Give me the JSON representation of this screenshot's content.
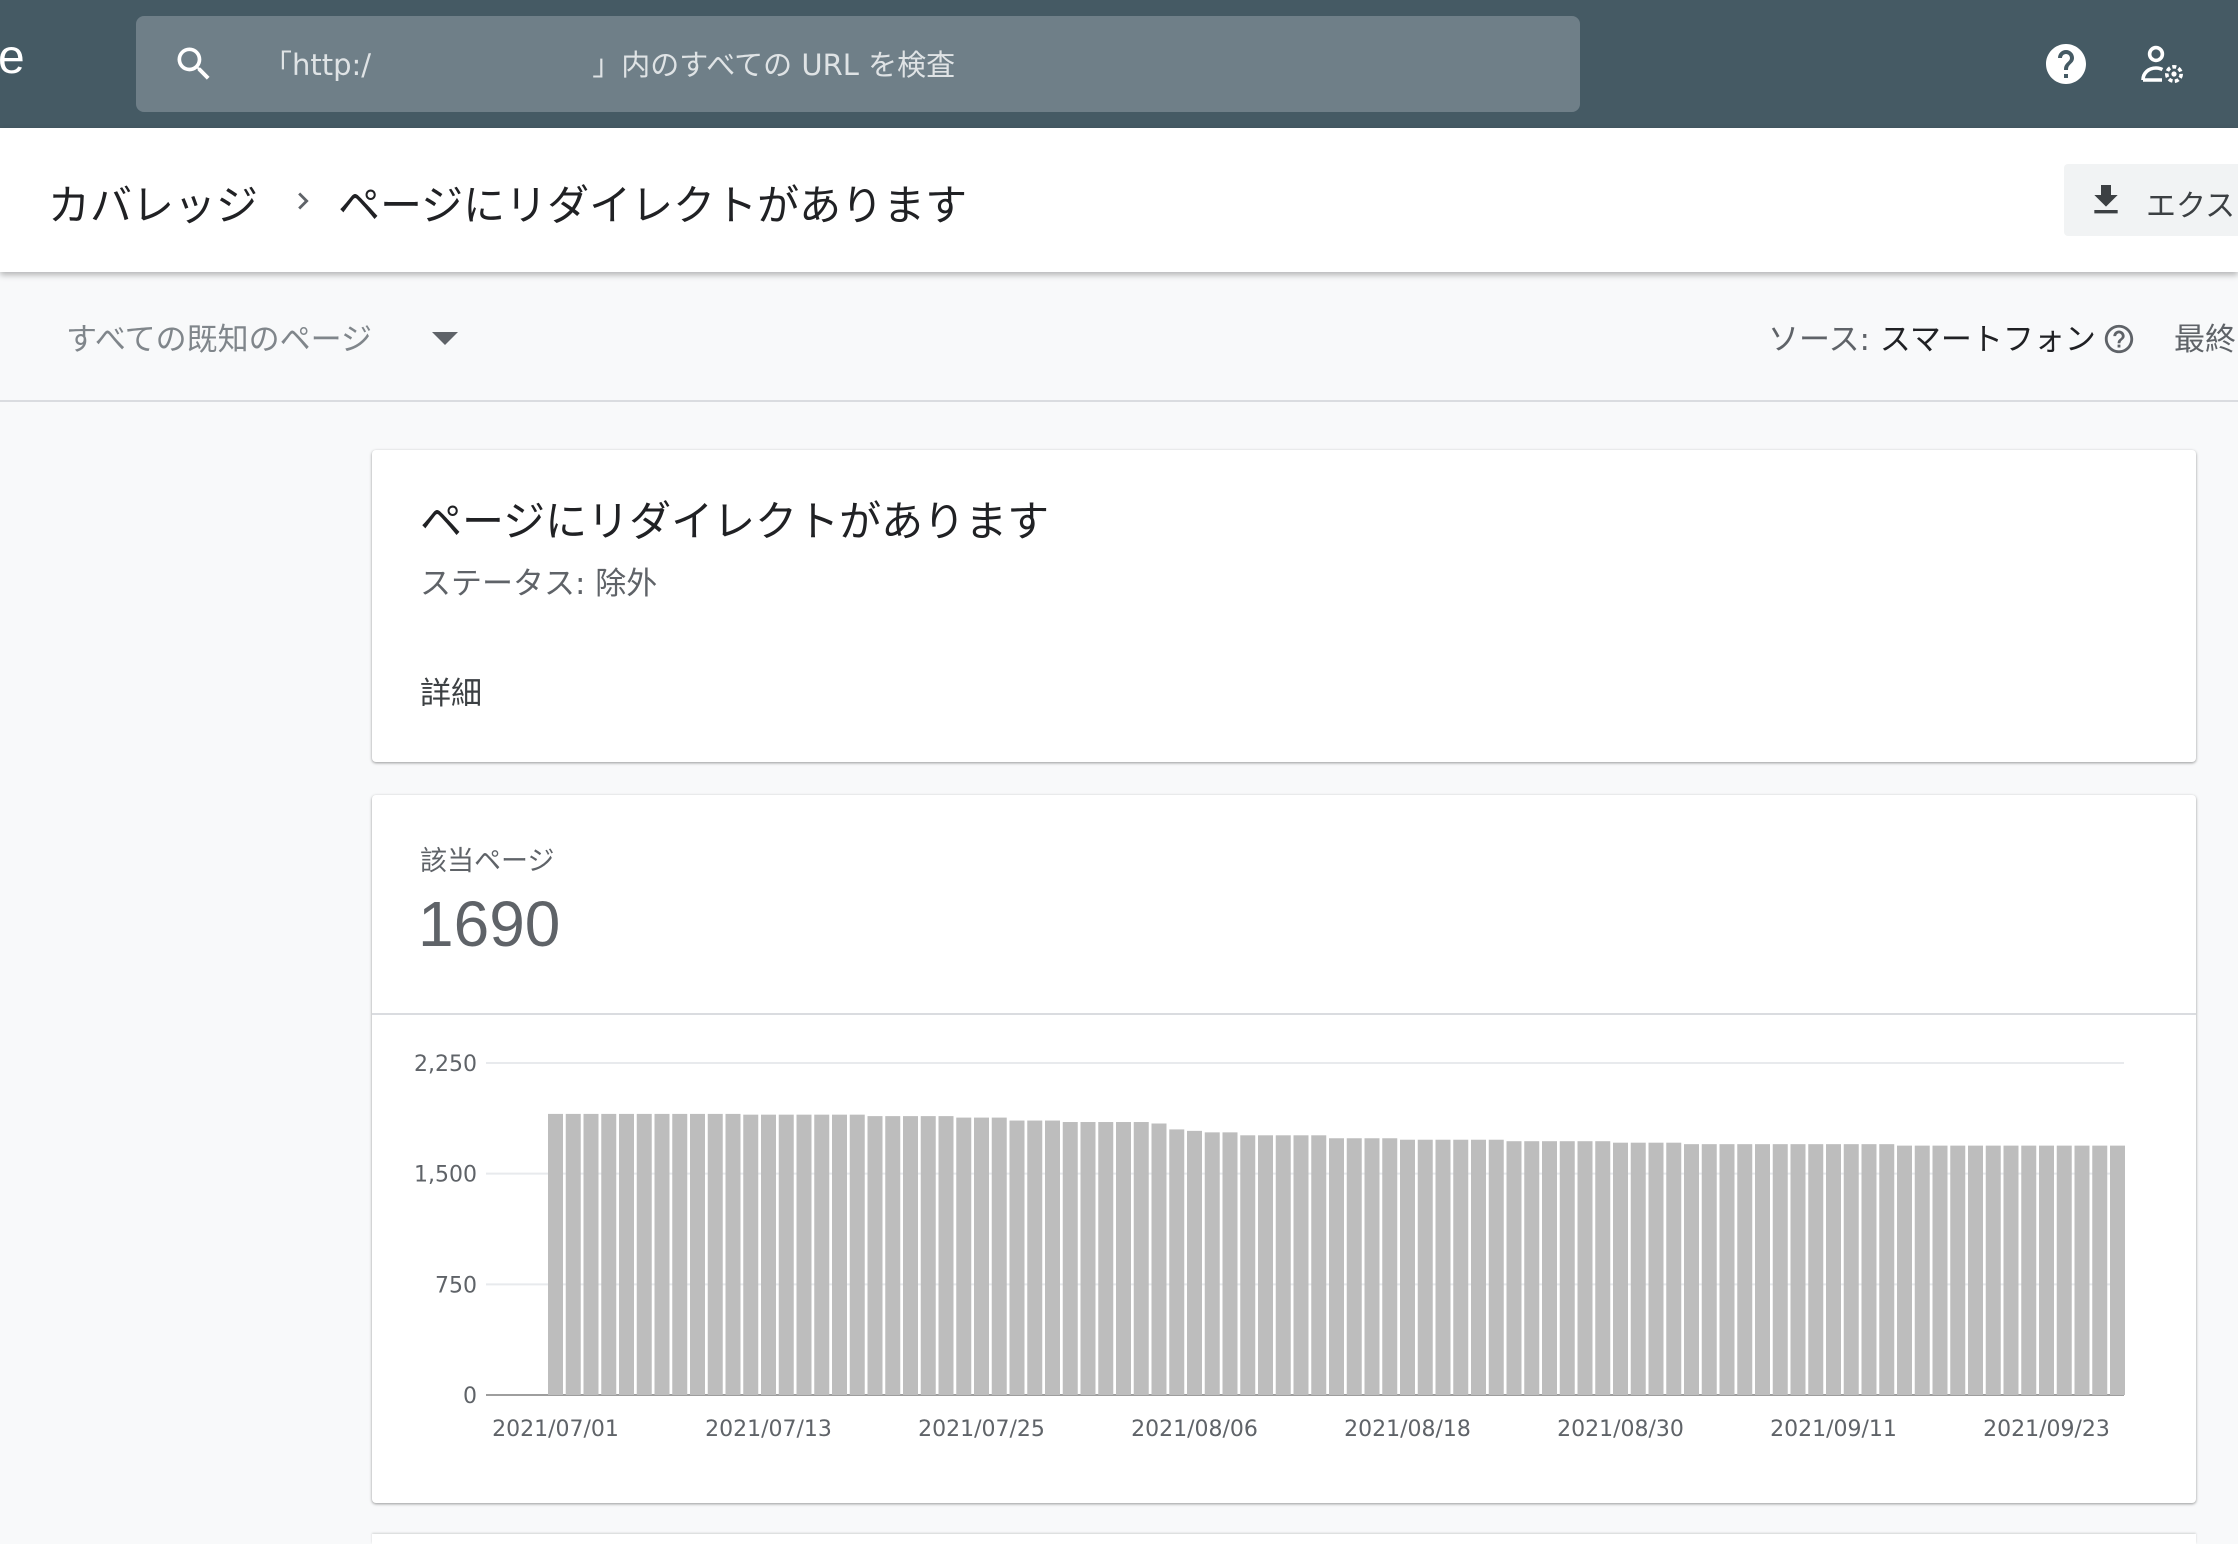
{
  "app": {
    "logo_fragment": "e"
  },
  "search": {
    "placeholder_prefix": "「http:/",
    "placeholder_suffix": "」内のすべての URL を検査",
    "placeholder": "「http:/                        」内のすべての URL を検査",
    "icon": "search-icon"
  },
  "topbar_icons": [
    "help-icon",
    "account-settings-icon"
  ],
  "header": {
    "breadcrumb_root": "カバレッジ",
    "breadcrumb_current": "ページにリダイレクトがあります",
    "export_label": "エクス",
    "export_icon": "download-icon"
  },
  "filterbar": {
    "dropdown_value": "すべての既知のページ",
    "source_label": "ソース: ",
    "source_value": "スマートフォン",
    "last_updated_fragment": "最終"
  },
  "issue_card": {
    "title": "ページにリダイレクトがあります",
    "status": "ステータス: 除外",
    "details_label": "詳細"
  },
  "count_card": {
    "label": "該当ページ",
    "count": "1690"
  },
  "colors": {
    "topbar": "#455a64",
    "bar": "#bdbdbd"
  },
  "chart_data": {
    "type": "bar",
    "start_date": "2021/07/01",
    "x_tick_labels": [
      "2021/07/01",
      "2021/07/13",
      "2021/07/25",
      "2021/08/06",
      "2021/08/18",
      "2021/08/30",
      "2021/09/11",
      "2021/09/23"
    ],
    "y_ticks": [
      0,
      750,
      1500,
      2250
    ],
    "y_tick_labels": [
      "0",
      "750",
      "1,500",
      "2,250"
    ],
    "ylim": [
      0,
      2250
    ],
    "grid": true,
    "values": [
      1905,
      1905,
      1905,
      1905,
      1905,
      1905,
      1905,
      1905,
      1905,
      1905,
      1905,
      1900,
      1900,
      1900,
      1900,
      1900,
      1900,
      1900,
      1890,
      1890,
      1890,
      1890,
      1890,
      1880,
      1880,
      1880,
      1860,
      1860,
      1860,
      1850,
      1850,
      1850,
      1850,
      1850,
      1840,
      1800,
      1790,
      1780,
      1780,
      1760,
      1760,
      1760,
      1760,
      1760,
      1740,
      1740,
      1740,
      1740,
      1730,
      1730,
      1730,
      1730,
      1730,
      1730,
      1720,
      1720,
      1720,
      1720,
      1720,
      1720,
      1710,
      1710,
      1710,
      1710,
      1700,
      1700,
      1700,
      1700,
      1700,
      1700,
      1700,
      1700,
      1700,
      1700,
      1700,
      1700,
      1690,
      1690,
      1690,
      1690,
      1690,
      1690,
      1690,
      1690,
      1690,
      1690,
      1690,
      1690,
      1690
    ]
  }
}
